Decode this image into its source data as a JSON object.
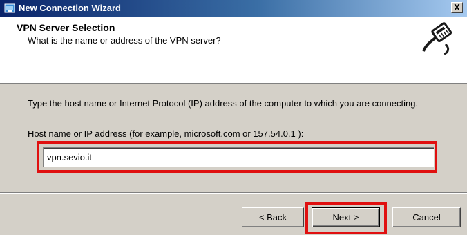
{
  "window": {
    "title": "New Connection Wizard",
    "close_label": "X"
  },
  "header": {
    "title": "VPN Server Selection",
    "subtitle": "What is the name or address of the VPN server?",
    "art_icon": "vpn-cable-icon"
  },
  "main": {
    "description": "Type the host name or Internet Protocol (IP) address of the computer to which you are connecting.",
    "field_label": "Host name or IP address (for example, microsoft.com or 157.54.0.1 ):",
    "host_value": "vpn.sevio.it"
  },
  "buttons": {
    "back": "< Back",
    "next": "Next >",
    "cancel": "Cancel"
  },
  "colors": {
    "titlebar": "#0a246a",
    "highlight": "#e01010",
    "dialog": "#d4d0c8"
  }
}
